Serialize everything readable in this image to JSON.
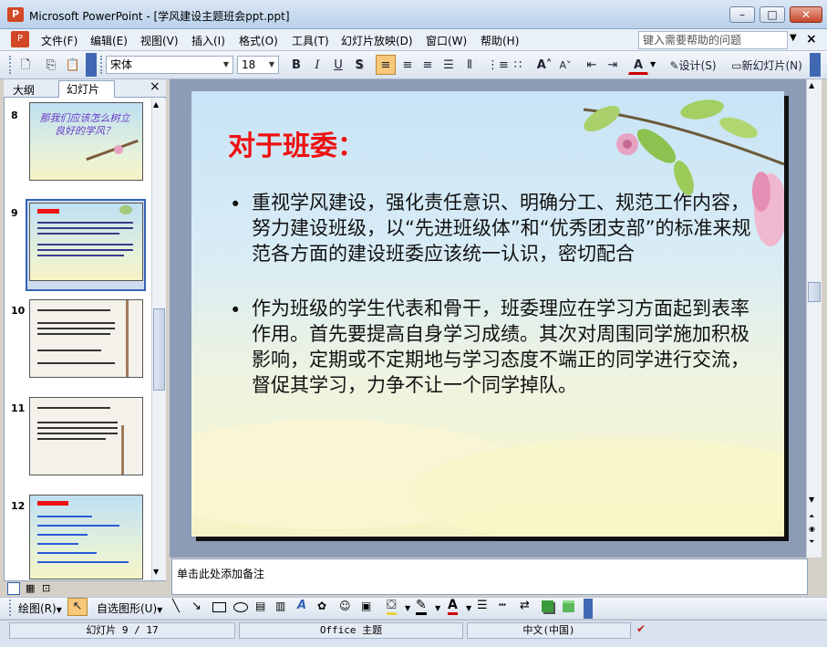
{
  "window": {
    "title": "Microsoft PowerPoint - [学风建设主题班会ppt.ppt]",
    "app_icon": "powerpoint-icon",
    "min_icon": "minimize-icon",
    "max_icon": "maximize-icon",
    "close_icon": "close-icon"
  },
  "menubar": {
    "items": [
      "文件(F)",
      "编辑(E)",
      "视图(V)",
      "插入(I)",
      "格式(O)",
      "工具(T)",
      "幻灯片放映(D)",
      "窗口(W)",
      "帮助(H)"
    ],
    "help_placeholder": "键入需要帮助的问题"
  },
  "toolbar": {
    "font_name": "宋体",
    "font_size": "18",
    "bold": "B",
    "italic": "I",
    "underline": "U",
    "shadow": "S",
    "design_label": "设计(S)",
    "new_slide_label": "新幻灯片(N)",
    "font_color": "#cc0000"
  },
  "pane": {
    "tab_outline": "大纲",
    "tab_slides": "幻灯片",
    "thumbnails": [
      {
        "num": "8",
        "text": "那我们应该怎么树立良好的学风？"
      },
      {
        "num": "9",
        "text": ""
      },
      {
        "num": "10",
        "text": ""
      },
      {
        "num": "11",
        "text": ""
      },
      {
        "num": "12",
        "text": ""
      }
    ]
  },
  "slide": {
    "title": "对于班委：",
    "title_color": "#ee1111",
    "bullets": [
      "重视学风建设，强化责任意识、明确分工、规范工作内容，努力建设班级，以“先进班级体”和“优秀团支部”的标准来规范各方面的建设班委应该统一认识，密切配合",
      "作为班级的学生代表和骨干，班委理应在学习方面起到表率作用。首先要提高自身学习成绩。其次对周围同学施加积极影响，定期或不定期地与学习态度不端正的同学进行交流，督促其学习，力争不让一个同学掉队。"
    ],
    "bullet_char": "•"
  },
  "notes": {
    "placeholder": "单击此处添加备注"
  },
  "drawbar": {
    "draw_label": "绘图(R)",
    "autoshape_label": "自选图形(U)"
  },
  "status": {
    "slide_counter": "幻灯片 9 / 17",
    "theme": "Office 主题",
    "language": "中文(中国)"
  },
  "colors": {
    "accent": "#3164b5",
    "titlebar": "#b9d1ea"
  }
}
